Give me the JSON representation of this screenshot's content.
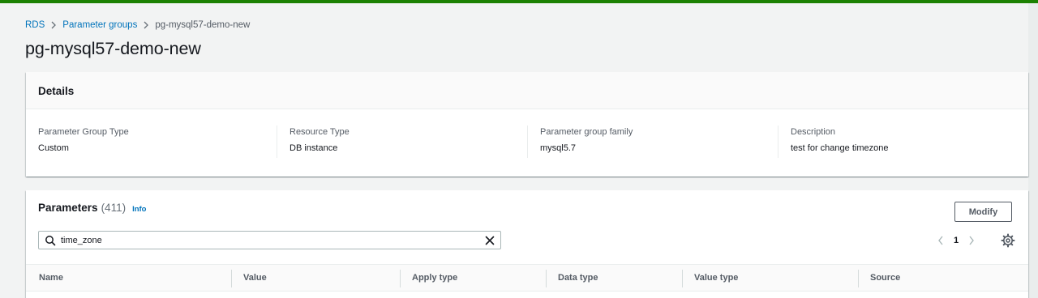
{
  "breadcrumb": {
    "items": [
      "RDS",
      "Parameter groups",
      "pg-mysql57-demo-new"
    ]
  },
  "page_title": "pg-mysql57-demo-new",
  "details": {
    "title": "Details",
    "fields": [
      {
        "label": "Parameter Group Type",
        "value": "Custom"
      },
      {
        "label": "Resource Type",
        "value": "DB instance"
      },
      {
        "label": "Parameter group family",
        "value": "mysql5.7"
      },
      {
        "label": "Description",
        "value": "test for change timezone"
      }
    ]
  },
  "parameters": {
    "title": "Parameters",
    "count": "(411)",
    "info_label": "Info",
    "modify_label": "Modify",
    "search": {
      "value": "time_zone",
      "placeholder": ""
    },
    "pagination": {
      "current_page": "1"
    },
    "columns": [
      "Name",
      "Value",
      "Apply type",
      "Data type",
      "Value type",
      "Source"
    ]
  },
  "icons": {
    "breadcrumb_separator": "chevron-right-icon",
    "search": "search-icon",
    "clear": "close-icon",
    "prev": "chevron-left-icon",
    "next": "chevron-right-icon",
    "settings": "gear-icon"
  },
  "colors": {
    "top_accent": "#1d8102",
    "link": "#0073bb",
    "text": "#16191f",
    "muted": "#545b64",
    "background": "#f2f3f3"
  }
}
